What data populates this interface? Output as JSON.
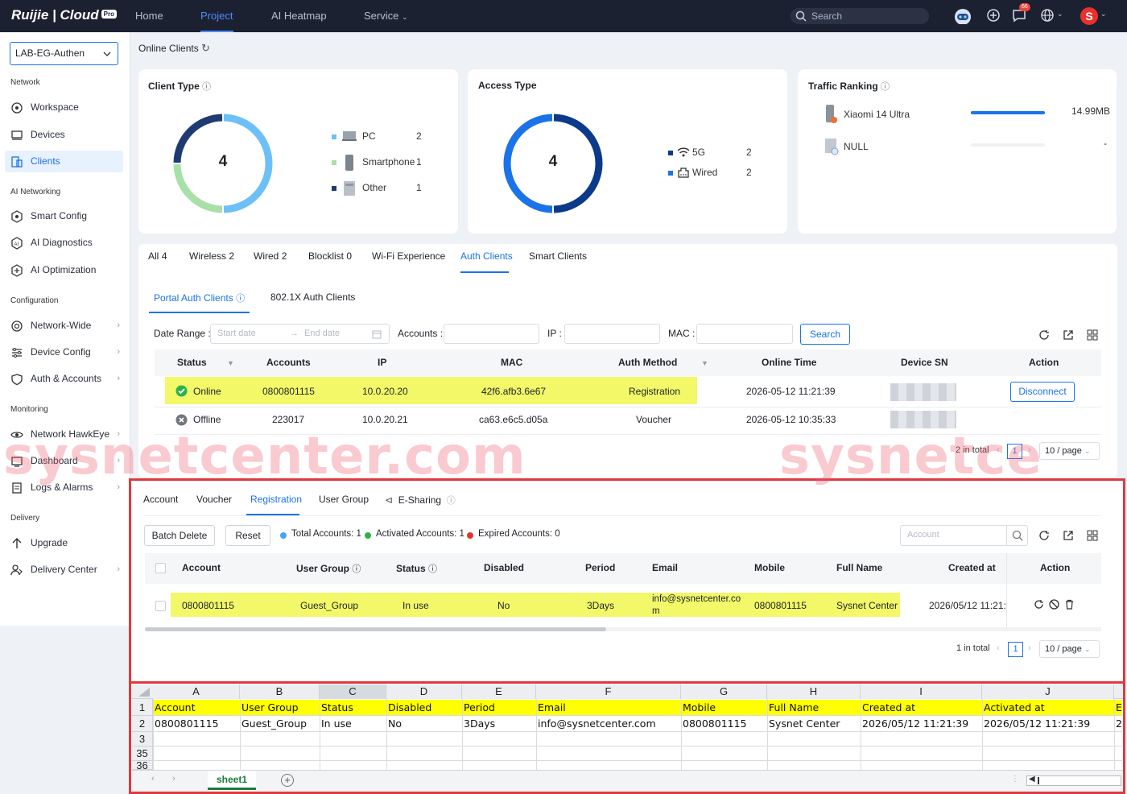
{
  "topbar": {
    "logo": "Ruijie | Cloud",
    "logo_badge": "Pro",
    "nav": [
      "Home",
      "Project",
      "AI Heatmap",
      "Service"
    ],
    "search_placeholder": "Search",
    "badge": "66"
  },
  "sidebar": {
    "site": "LAB-EG-Authen",
    "sections": {
      "network": "Network",
      "ai": "AI Networking",
      "config": "Configuration",
      "monitoring": "Monitoring",
      "delivery": "Delivery"
    },
    "items": {
      "workspace": "Workspace",
      "devices": "Devices",
      "clients": "Clients",
      "smart_config": "Smart Config",
      "ai_diag": "AI Diagnostics",
      "ai_opt": "AI Optimization",
      "network_wide": "Network-Wide",
      "device_config": "Device Config",
      "auth_accounts": "Auth & Accounts",
      "hawkeye": "Network HawkEye",
      "dashboard": "Dashboard",
      "logs": "Logs & Alarms",
      "upgrade": "Upgrade",
      "delivery_center": "Delivery Center"
    }
  },
  "page_title": "Online Clients",
  "client_type": {
    "title": "Client Type",
    "total": "4",
    "legend": [
      {
        "label": "PC",
        "count": "2",
        "color": "#6cc0f7"
      },
      {
        "label": "Smartphone",
        "count": "1",
        "color": "#a8e0a8"
      },
      {
        "label": "Other",
        "count": "1",
        "color": "#1f3b73"
      }
    ],
    "fractions": [
      0.5,
      0.25,
      0.25
    ]
  },
  "access_type": {
    "title": "Access Type",
    "total": "4",
    "legend": [
      {
        "label": "5G",
        "count": "2",
        "color": "#0b3a8a"
      },
      {
        "label": "Wired",
        "count": "2",
        "color": "#1a73e8"
      }
    ],
    "fractions": [
      0.5,
      0.5
    ]
  },
  "traffic": {
    "title": "Traffic Ranking",
    "rows": [
      {
        "name": "Xiaomi 14 Ultra",
        "value": "14.99MB",
        "fraction": 1
      },
      {
        "name": "NULL",
        "value": "-",
        "fraction": 0
      }
    ]
  },
  "tabs": [
    {
      "label": "All",
      "count": "4"
    },
    {
      "label": "Wireless",
      "count": "2"
    },
    {
      "label": "Wired",
      "count": "2"
    },
    {
      "label": "Blocklist",
      "count": "0"
    },
    {
      "label": "Wi-Fi Experience",
      "count": ""
    },
    {
      "label": "Auth Clients",
      "count": ""
    },
    {
      "label": "Smart Clients",
      "count": ""
    }
  ],
  "subtabs": [
    "Portal Auth Clients",
    "802.1X Auth Clients"
  ],
  "filter": {
    "date_label": "Date Range :",
    "start": "Start date",
    "end": "End date",
    "accounts_label": "Accounts :",
    "ip_label": "IP :",
    "mac_label": "MAC :",
    "search_btn": "Search"
  },
  "auth_table": {
    "headers": [
      "Status",
      "Accounts",
      "IP",
      "MAC",
      "Auth Method",
      "Online Time",
      "Device SN",
      "Action"
    ],
    "rows": [
      {
        "status": "Online",
        "account": "0800801115",
        "ip": "10.0.20.20",
        "mac": "42f6.afb3.6e67",
        "method": "Registration",
        "time": "2026-05-12 11:21:39",
        "action": "Disconnect"
      },
      {
        "status": "Offline",
        "account": "223017",
        "ip": "10.0.20.21",
        "mac": "ca63.e6c5.d05a",
        "method": "Voucher",
        "time": "2026-05-12 10:35:33",
        "action": ""
      }
    ],
    "total": "2 in total",
    "page": "1",
    "per_page": "10 / page"
  },
  "watermark": [
    "sysnetcenter.com",
    "sysnetce"
  ],
  "reg": {
    "tabs": [
      "Account",
      "Voucher",
      "Registration",
      "User Group",
      "E-Sharing"
    ],
    "batch_delete": "Batch Delete",
    "reset": "Reset",
    "stats": [
      {
        "label": "Total Accounts: 1",
        "color": "#4aa3f0"
      },
      {
        "label": "Activated Accounts: 1",
        "color": "#2bb24c"
      },
      {
        "label": "Expired Accounts: 0",
        "color": "#e8312b"
      }
    ],
    "search_placeholder": "Account",
    "headers": [
      "Account",
      "User Group",
      "Status",
      "Disabled",
      "Period",
      "Email",
      "Mobile",
      "Full Name",
      "Created at",
      "Action"
    ],
    "row": {
      "account": "0800801115",
      "group": "Guest_Group",
      "status": "In use",
      "disabled": "No",
      "period": "3Days",
      "email1": "info@sysnetcenter.co",
      "email2": "m",
      "mobile": "0800801115",
      "name": "Sysnet Center",
      "created": "2026/05/12 11:21:3"
    },
    "total": "1 in total",
    "page": "1",
    "per_page": "10 / page"
  },
  "excel": {
    "cols": [
      "A",
      "B",
      "C",
      "D",
      "E",
      "F",
      "G",
      "H",
      "I",
      "J"
    ],
    "rows": [
      "1",
      "2",
      "3",
      "35",
      "36"
    ],
    "header_row": [
      "Account",
      "User Group",
      "Status",
      "Disabled",
      "Period",
      "Email",
      "Mobile",
      "Full Name",
      "Created at",
      "Activated at",
      "E"
    ],
    "data_row": [
      "0800801115",
      "Guest_Group",
      "In use",
      "No",
      "3Days",
      "info@sysnetcenter.com",
      "0800801115",
      "Sysnet Center",
      "2026/05/12 11:21:39",
      "2026/05/12 11:21:39",
      "2"
    ],
    "sheet": "sheet1"
  }
}
